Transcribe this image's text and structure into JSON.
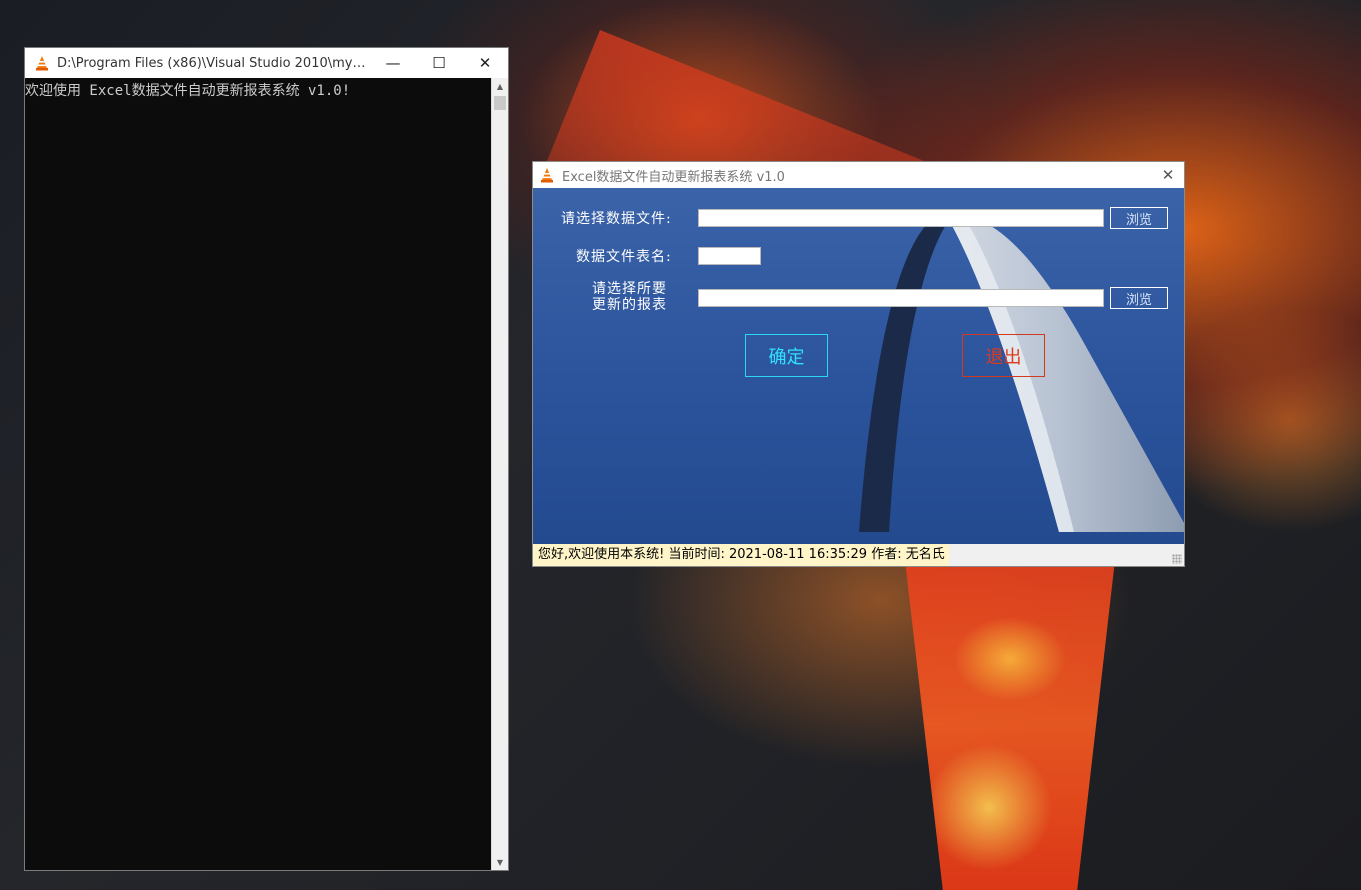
{
  "console": {
    "title": "D:\\Program Files (x86)\\Visual Studio 2010\\myproj...",
    "output_line": "欢迎使用 Excel数据文件自动更新报表系统 v1.0!",
    "minimize_glyph": "—",
    "maximize_glyph": "☐",
    "close_glyph": "✕"
  },
  "dialog": {
    "title": "Excel数据文件自动更新报表系统 v1.0",
    "close_glyph": "✕",
    "label_data_file": "请选择数据文件:",
    "label_sheet_name": "数据文件表名:",
    "label_report_line1": "请选择所要",
    "label_report_line2": "更新的报表",
    "data_file_value": "",
    "sheet_name_value": "",
    "report_file_value": "",
    "browse_label": "浏览",
    "ok_label": "确定",
    "exit_label": "退出",
    "status_text": "您好,欢迎使用本系统!  当前时间:  2021-08-11 16:35:29  作者:  无名氏"
  },
  "colors": {
    "ok_accent": "#30e0ff",
    "exit_accent": "#e03a18",
    "dialog_background": "#2c559e"
  },
  "icons": {
    "app_icon": "vlc-cone-icon"
  }
}
